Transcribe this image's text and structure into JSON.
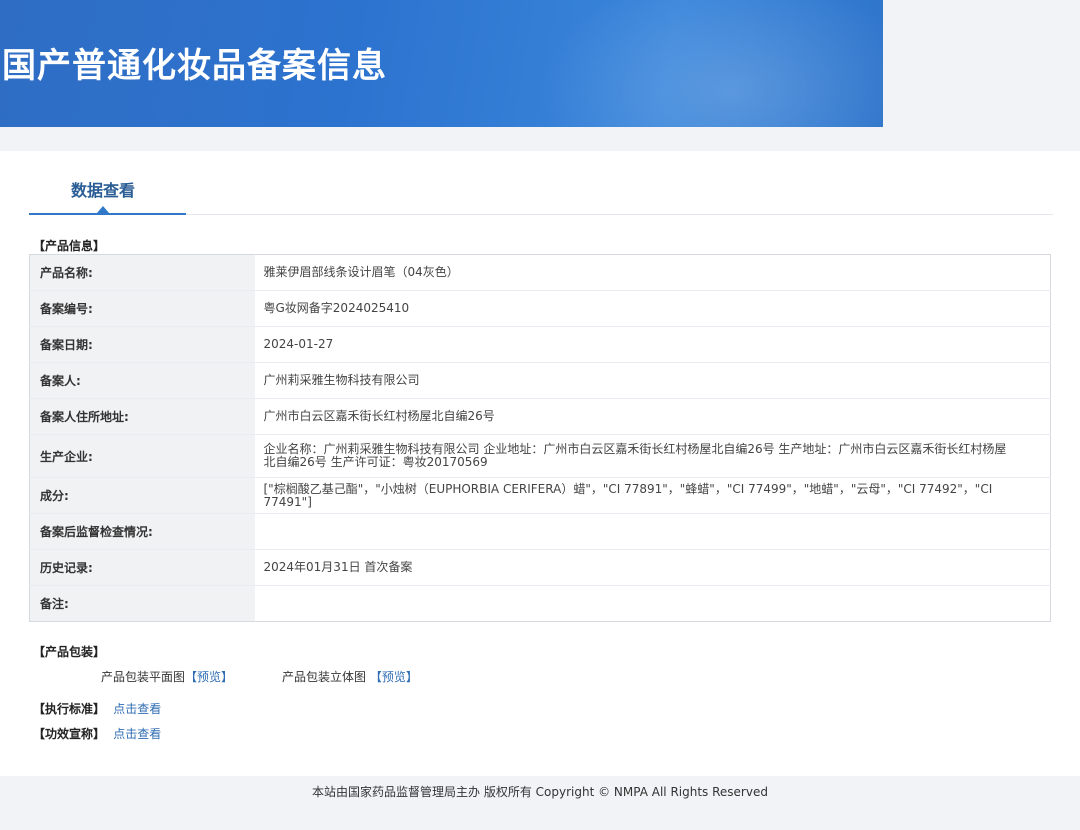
{
  "header": {
    "title": "国产普通化妆品备案信息"
  },
  "tabs": [
    {
      "label": "数据查看",
      "active": true
    }
  ],
  "product_info": {
    "section_title": "【产品信息】",
    "rows": [
      {
        "label": "产品名称:",
        "value": "雅莱伊眉部线条设计眉笔（04灰色）"
      },
      {
        "label": "备案编号:",
        "value": "粤G妆网备字2024025410"
      },
      {
        "label": "备案日期:",
        "value": "2024-01-27"
      },
      {
        "label": "备案人:",
        "value": "广州莉采雅生物科技有限公司"
      },
      {
        "label": "备案人住所地址:",
        "value": "广州市白云区嘉禾街长红村杨屋北自编26号"
      },
      {
        "label": "生产企业:",
        "value": "企业名称：广州莉采雅生物科技有限公司 企业地址：广州市白云区嘉禾街长红村杨屋北自编26号 生产地址：广州市白云区嘉禾街长红村杨屋北自编26号 生产许可证：粤妆20170569"
      },
      {
        "label": "成分:",
        "value": "[\"棕榈酸乙基己酯\"，\"小烛树（EUPHORBIA CERIFERA）蜡\"，\"CI 77891\"，\"蜂蜡\"，\"CI 77499\"，\"地蜡\"，\"云母\"，\"CI 77492\"，\"CI 77491\"]"
      },
      {
        "label": "备案后监督检查情况:",
        "value": ""
      },
      {
        "label": "历史记录:",
        "value": "2024年01月31日 首次备案"
      },
      {
        "label": "备注:",
        "value": ""
      }
    ]
  },
  "packaging": {
    "section_title": "【产品包装】",
    "flat_label": "产品包装平面图",
    "flat_link": "【预览】",
    "solid_label": "产品包装立体图",
    "solid_link": "【预览】"
  },
  "standard": {
    "section_title": "【执行标准】",
    "link": "点击查看"
  },
  "efficacy": {
    "section_title": "【功效宣称】",
    "link": "点击查看"
  },
  "footer": {
    "text": "本站由国家药品监督管理局主办 版权所有 Copyright © NMPA All Rights Reserved"
  },
  "colors": {
    "banner": "#2f6dc4",
    "tab_accent": "#2f79c8",
    "tab_text": "#2a5d95",
    "link": "#2f6db3",
    "label_bg": "#f1f2f4"
  }
}
